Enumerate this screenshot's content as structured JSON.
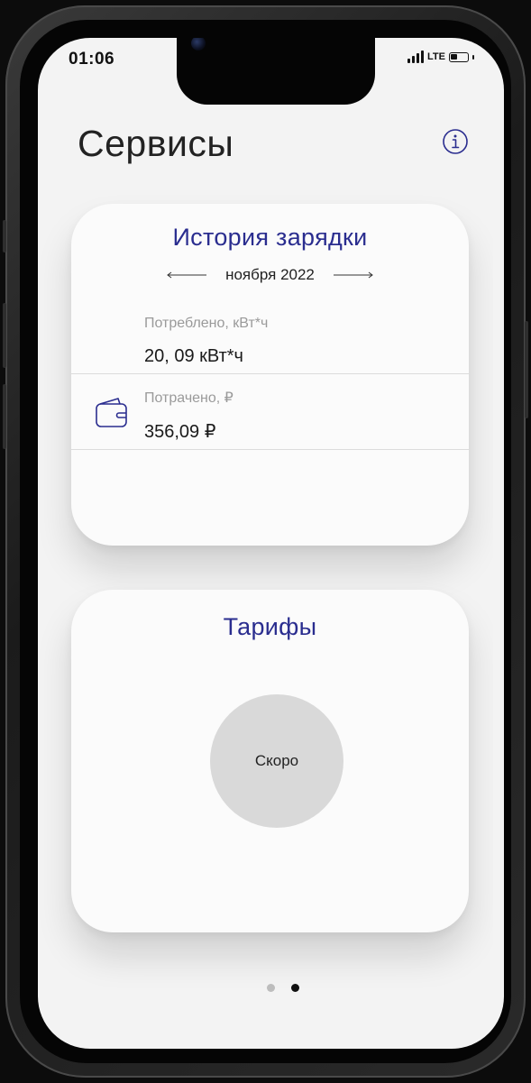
{
  "status_bar": {
    "time": "01:06",
    "network": "LTE",
    "battery_level": 0.4
  },
  "header": {
    "title": "Сервисы",
    "info_icon": "info-icon"
  },
  "history_card": {
    "title": "История зарядки",
    "period": "ноября 2022",
    "prev_icon": "arrow-left-icon",
    "next_icon": "arrow-right-icon",
    "consumed_label": "Потреблено, кВт*ч",
    "consumed_value": "20, 09 кВт*ч",
    "spent_icon": "wallet-icon",
    "spent_label": "Потрачено, ₽",
    "spent_value": "356,09 ₽"
  },
  "tariffs_card": {
    "title": "Тарифы",
    "soon_label": "Скоро"
  },
  "pagination": {
    "pages": 2,
    "active_index": 1
  },
  "colors": {
    "accent": "#2a2d8f",
    "screen_bg": "#f3f3f3",
    "card_bg": "#fbfbfb",
    "muted_text": "#9a9a9a",
    "dot_inactive": "#bdbdbd",
    "dot_active": "#111111"
  }
}
